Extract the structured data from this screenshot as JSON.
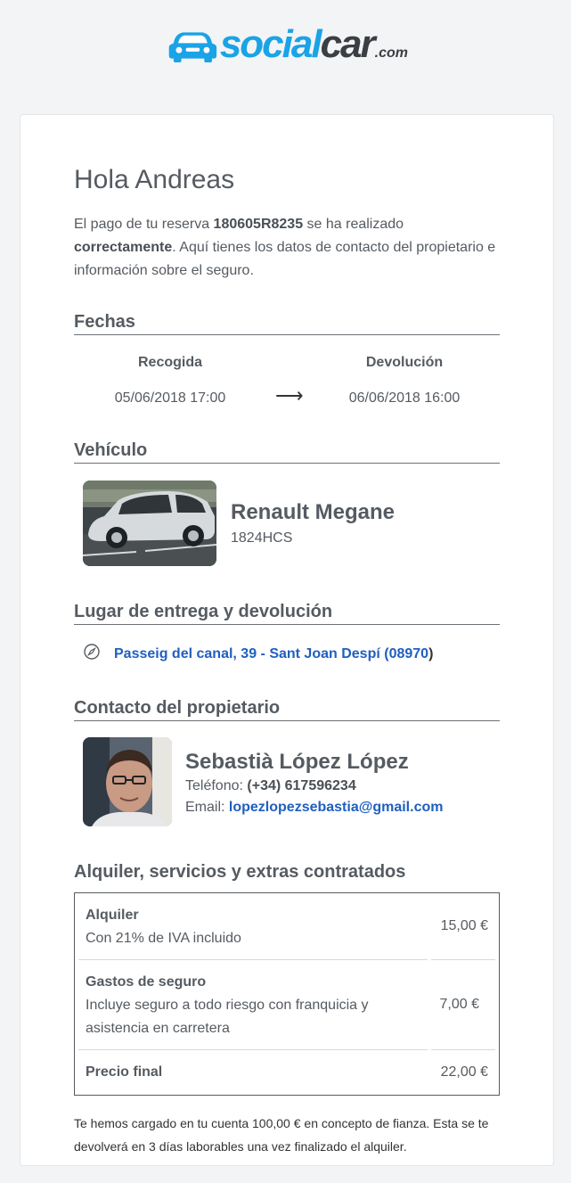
{
  "brand": {
    "social": "social",
    "car": "car",
    "com": ".com",
    "colors": {
      "primary": "#1aa3e6",
      "dark": "#3b3f44",
      "link": "#1f5fbf"
    }
  },
  "greeting": "Hola Andreas",
  "intro": {
    "p1": "El pago de tu reserva ",
    "booking_id": "180605R8235",
    "p2": " se ha realizado ",
    "status": "correctamente",
    "p3": ". Aquí tienes los datos de contacto del propietario e información sobre el seguro."
  },
  "dates": {
    "title": "Fechas",
    "pickup_label": "Recogida",
    "pickup_value": "05/06/2018 17:00",
    "arrow": "⟶",
    "return_label": "Devolución",
    "return_value": "06/06/2018 16:00"
  },
  "vehicle": {
    "title": "Vehículo",
    "name": "Renault Megane",
    "plate": "1824HCS"
  },
  "place": {
    "title": "Lugar de entrega y devolución",
    "icon": "compass-icon",
    "address": "Passeig del canal, 39 - Sant Joan Despí (08970",
    "address_tail": ")"
  },
  "owner": {
    "title": "Contacto del propietario",
    "name": "Sebastià López López",
    "phone_label": "Teléfono: ",
    "phone": "(+34) 617596234",
    "email_label": "Email: ",
    "email": "lopezlopezsebastia@gmail.com"
  },
  "extras": {
    "title": "Alquiler, servicios y extras contratados",
    "rows": [
      {
        "name": "Alquiler",
        "detail": "Con 21% de IVA incluido",
        "price": "15,00 €"
      },
      {
        "name": "Gastos de seguro",
        "detail": "Incluye seguro a todo riesgo con franquicia y asistencia en carretera",
        "price": "7,00 €"
      },
      {
        "name": "Precio final",
        "detail": "",
        "price": "22,00 €"
      }
    ]
  },
  "footnote": "Te hemos cargado en tu cuenta 100,00 € en concepto de fianza. Esta se te devolverá en 3 días laborables una vez finalizado el alquiler."
}
